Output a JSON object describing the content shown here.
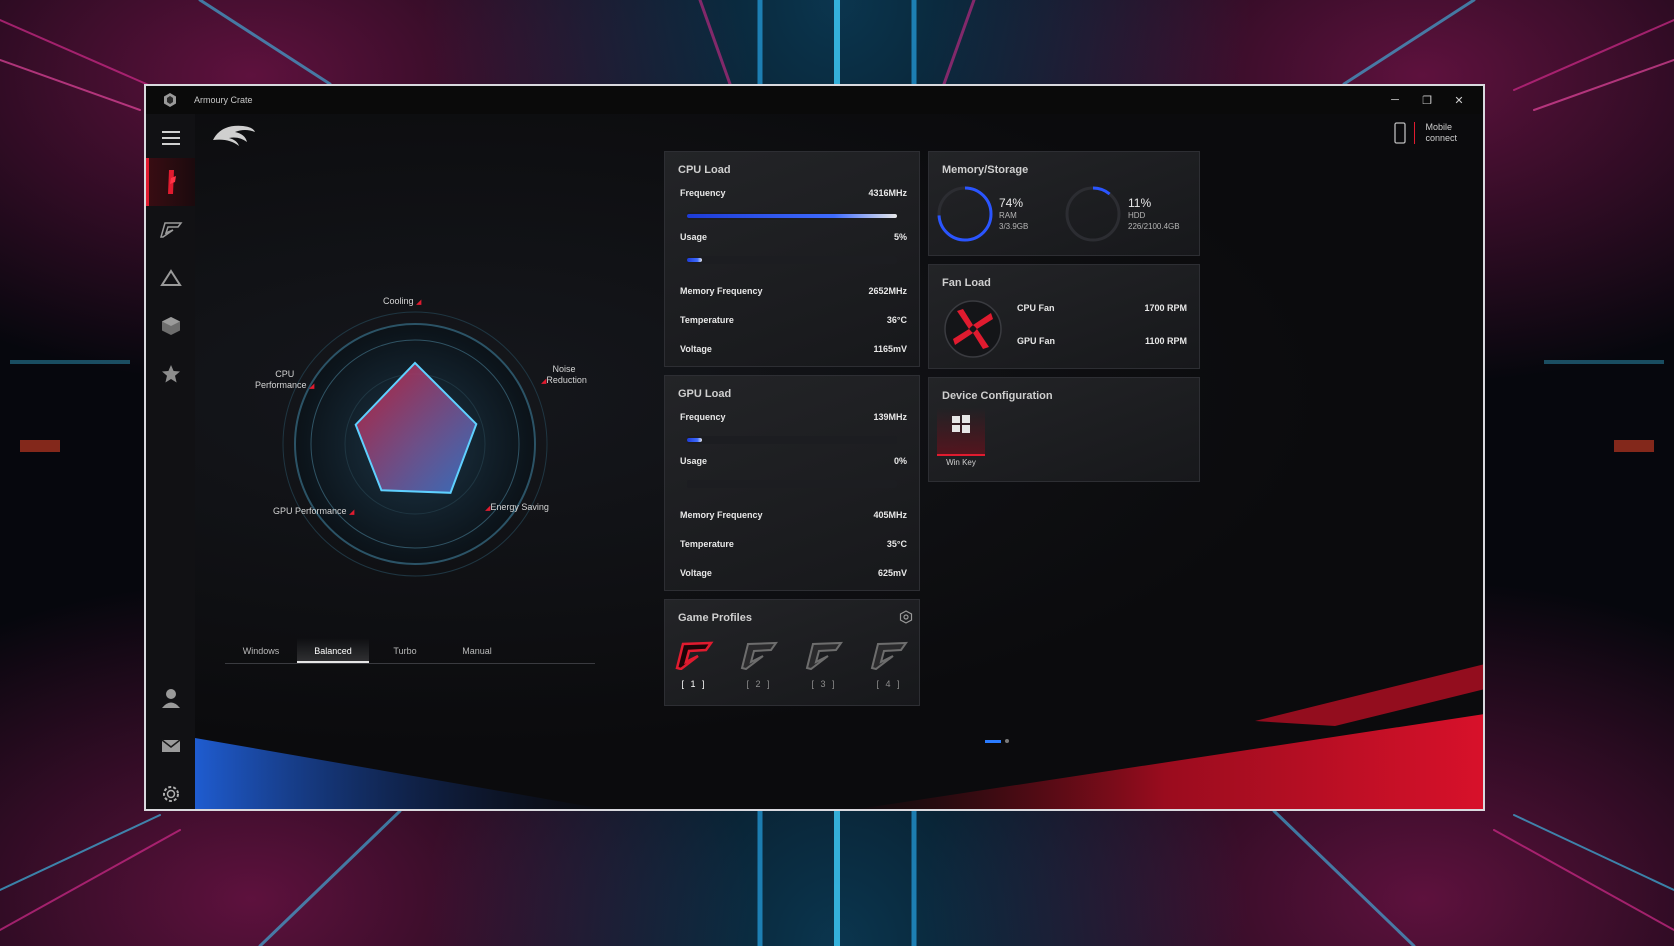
{
  "window": {
    "title": "Armoury Crate",
    "minimize_glyph": "─",
    "restore_glyph": "❐",
    "close_glyph": "✕"
  },
  "header": {
    "logo": "rog-eye-icon",
    "mobile_connect_line1": "Mobile",
    "mobile_connect_line2": "connect"
  },
  "sidebar": {
    "items": [
      {
        "name": "menu",
        "icon": "hamburger-icon",
        "active": false
      },
      {
        "name": "home",
        "icon": "slash-icon",
        "active": true
      },
      {
        "name": "device",
        "icon": "rog-gadget-icon",
        "active": false
      },
      {
        "name": "aura",
        "icon": "triangle-icon",
        "active": false
      },
      {
        "name": "library",
        "icon": "cube-icon",
        "active": false
      },
      {
        "name": "featured",
        "icon": "star-icon",
        "active": false
      },
      {
        "name": "user",
        "icon": "user-icon",
        "active": false
      },
      {
        "name": "news",
        "icon": "mail-icon",
        "active": false
      },
      {
        "name": "settings",
        "icon": "gear-icon",
        "active": false
      }
    ]
  },
  "radar": {
    "labels": {
      "cooling": "Cooling",
      "noise_line1": "Noise",
      "noise_line2": "Reduction",
      "energy": "Energy Saving",
      "gpu": "GPU Performance",
      "cpu_line1": "CPU",
      "cpu_line2": "Performance"
    },
    "values": {
      "cooling": 0.78,
      "noise": 0.62,
      "energy": 0.58,
      "gpu": 0.55,
      "cpu": 0.6
    }
  },
  "modes": {
    "tabs": [
      "Windows",
      "Balanced",
      "Turbo",
      "Manual"
    ],
    "active": "Balanced"
  },
  "cpu": {
    "title": "CPU Load",
    "frequency_label": "Frequency",
    "frequency_value": "4316MHz",
    "frequency_fraction": 1.0,
    "usage_label": "Usage",
    "usage_value": "5%",
    "usage_fraction": 0.05,
    "mem_freq_label": "Memory Frequency",
    "mem_freq_value": "2652MHz",
    "temp_label": "Temperature",
    "temp_value": "36°C",
    "voltage_label": "Voltage",
    "voltage_value": "1165mV"
  },
  "gpu": {
    "title": "GPU Load",
    "frequency_label": "Frequency",
    "frequency_value": "139MHz",
    "frequency_fraction": 0.07,
    "usage_label": "Usage",
    "usage_value": "0%",
    "usage_fraction": 0.0,
    "mem_freq_label": "Memory Frequency",
    "mem_freq_value": "405MHz",
    "temp_label": "Temperature",
    "temp_value": "35°C",
    "voltage_label": "Voltage",
    "voltage_value": "625mV"
  },
  "memory": {
    "title": "Memory/Storage",
    "ram_pct": "74%",
    "ram_label": "RAM",
    "ram_detail": "3/3.9GB",
    "ram_fraction": 0.74,
    "hdd_pct": "11%",
    "hdd_label": "HDD",
    "hdd_detail": "226/2100.4GB",
    "hdd_fraction": 0.11
  },
  "fan": {
    "title": "Fan Load",
    "cpu_label": "CPU Fan",
    "cpu_value": "1700  RPM",
    "gpu_label": "GPU Fan",
    "gpu_value": "1100  RPM"
  },
  "device_config": {
    "title": "Device Configuration",
    "win_key_label": "Win Key"
  },
  "game_profiles": {
    "title": "Game Profiles",
    "profiles": [
      "[ 1 ]",
      "[ 2 ]",
      "[ 3 ]",
      "[ 4 ]"
    ],
    "active_index": 0
  },
  "colors": {
    "accent_red": "#e01b2f",
    "accent_blue": "#2a55ff",
    "card_bg": "#1e1f22"
  }
}
